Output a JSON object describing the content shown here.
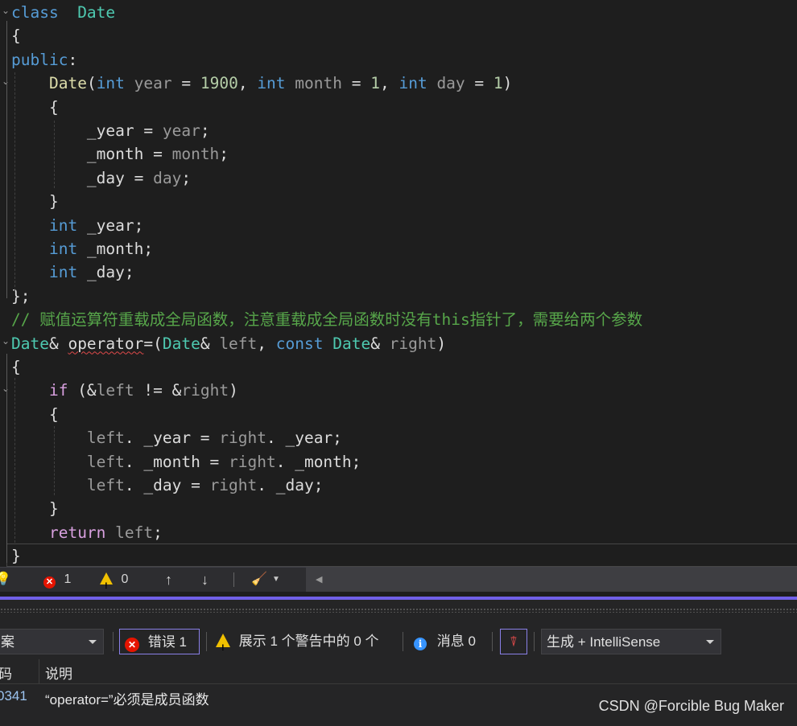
{
  "editor": {
    "lines": [
      [
        [
          "kw",
          "class"
        ],
        [
          "",
          "  "
        ],
        [
          "cls",
          "Date"
        ]
      ],
      [
        [
          "",
          "{"
        ]
      ],
      [
        [
          "kw",
          "public"
        ],
        [
          "",
          ":"
        ]
      ],
      [
        [
          "",
          "    "
        ],
        [
          "fn",
          "Date"
        ],
        [
          "",
          "("
        ],
        [
          "kw",
          "int"
        ],
        [
          "var",
          " year"
        ],
        [
          "",
          " = "
        ],
        [
          "num",
          "1900"
        ],
        [
          "",
          ", "
        ],
        [
          "kw",
          "int"
        ],
        [
          "var",
          " month"
        ],
        [
          "",
          " = "
        ],
        [
          "num",
          "1"
        ],
        [
          "",
          ", "
        ],
        [
          "kw",
          "int"
        ],
        [
          "var",
          " day"
        ],
        [
          "",
          " = "
        ],
        [
          "num",
          "1"
        ],
        [
          "",
          ")"
        ]
      ],
      [
        [
          "",
          "    {"
        ]
      ],
      [
        [
          "",
          "        _year = "
        ],
        [
          "var",
          "year"
        ],
        [
          "",
          ";"
        ]
      ],
      [
        [
          "",
          "        _month = "
        ],
        [
          "var",
          "month"
        ],
        [
          "",
          ";"
        ]
      ],
      [
        [
          "",
          "        _day = "
        ],
        [
          "var",
          "day"
        ],
        [
          "",
          ";"
        ]
      ],
      [
        [
          "",
          "    }"
        ]
      ],
      [
        [
          "",
          "    "
        ],
        [
          "kw",
          "int"
        ],
        [
          "",
          " _year;"
        ]
      ],
      [
        [
          "",
          "    "
        ],
        [
          "kw",
          "int"
        ],
        [
          "",
          " _month;"
        ]
      ],
      [
        [
          "",
          "    "
        ],
        [
          "kw",
          "int"
        ],
        [
          "",
          " _day;"
        ]
      ],
      [
        [
          "",
          "};"
        ]
      ],
      [
        [
          "cmt",
          "// 赋值运算符重载成全局函数，注意重载成全局函数时没有this指针了，需要给两个参数"
        ]
      ],
      [
        [
          "cls",
          "Date"
        ],
        [
          "",
          "& "
        ],
        [
          "err",
          "operator"
        ],
        [
          "",
          "=("
        ],
        [
          "cls",
          "Date"
        ],
        [
          "",
          "& "
        ],
        [
          "var",
          "left"
        ],
        [
          "",
          ", "
        ],
        [
          "kw",
          "const"
        ],
        [
          "",
          " "
        ],
        [
          "cls",
          "Date"
        ],
        [
          "",
          "& "
        ],
        [
          "var",
          "right"
        ],
        [
          "",
          ")"
        ]
      ],
      [
        [
          "",
          "{"
        ]
      ],
      [
        [
          "",
          "    "
        ],
        [
          "ctl",
          "if"
        ],
        [
          "",
          " (&"
        ],
        [
          "var",
          "left"
        ],
        [
          "",
          " != &"
        ],
        [
          "var",
          "right"
        ],
        [
          "",
          ")"
        ]
      ],
      [
        [
          "",
          "    {"
        ]
      ],
      [
        [
          "",
          "        "
        ],
        [
          "var",
          "left"
        ],
        [
          "",
          ". _year = "
        ],
        [
          "var",
          "right"
        ],
        [
          "",
          ". _year;"
        ]
      ],
      [
        [
          "",
          "        "
        ],
        [
          "var",
          "left"
        ],
        [
          "",
          ". _month = "
        ],
        [
          "var",
          "right"
        ],
        [
          "",
          ". _month;"
        ]
      ],
      [
        [
          "",
          "        "
        ],
        [
          "var",
          "left"
        ],
        [
          "",
          ". _day = "
        ],
        [
          "var",
          "right"
        ],
        [
          "",
          ". _day;"
        ]
      ],
      [
        [
          "",
          "    }"
        ]
      ],
      [
        [
          "",
          "    "
        ],
        [
          "ctl",
          "return"
        ],
        [
          "var",
          " left"
        ],
        [
          "",
          ";"
        ]
      ],
      [
        [
          "",
          "}"
        ]
      ]
    ]
  },
  "status": {
    "errors": "1",
    "warnings": "0"
  },
  "error_list": {
    "scope": "案",
    "errors_label": "错误 1",
    "warnings_label": "展示 1 个警告中的 0 个",
    "messages_label": "消息 0",
    "source": "生成 + IntelliSense",
    "columns": {
      "code": "码",
      "description": "说明"
    },
    "rows": [
      {
        "code": "0341",
        "description": "“operator=”必须是成员函数"
      }
    ]
  },
  "colors": {
    "keyword": "#569cd6",
    "type": "#4ec9b0",
    "function": "#dcdcaa",
    "comment": "#57a64a",
    "accent": "#7160e8",
    "error": "#e51400"
  },
  "watermark": "CSDN @Forcible Bug Maker"
}
